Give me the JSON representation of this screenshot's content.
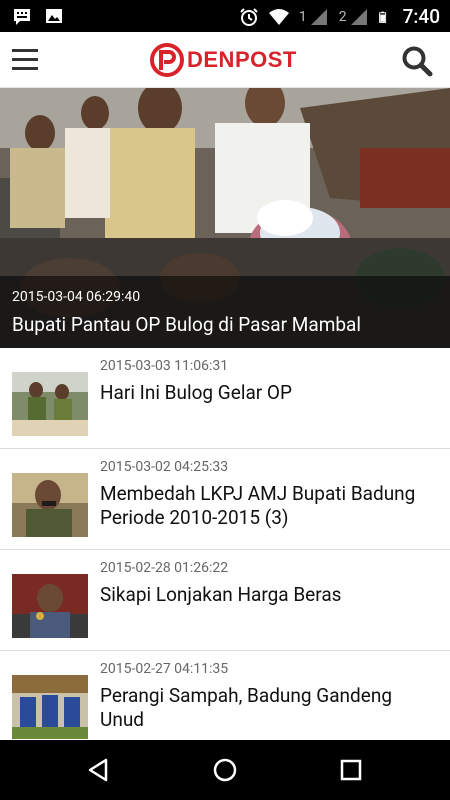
{
  "status_bar": {
    "sim1": "1",
    "sim2": "2",
    "time": "7:40",
    "icons": [
      "message-notification-icon",
      "image-notification-icon",
      "alarm-icon",
      "wifi-icon",
      "signal-icon",
      "battery-icon"
    ]
  },
  "app_bar": {
    "logo_text": "DENPOST",
    "brand_color": "#d8232a"
  },
  "hero": {
    "date": "2015-03-04 06:29:40",
    "title": "Bupati Pantau OP Bulog di Pasar Mambal"
  },
  "articles": [
    {
      "date": "2015-03-03 11:06:31",
      "title": "Hari Ini Bulog Gelar OP"
    },
    {
      "date": "2015-03-02 04:25:33",
      "title": "Membedah LKPJ AMJ Bupati Badung Periode 2010-2015 (3)"
    },
    {
      "date": "2015-02-28 01:26:22",
      "title": "Sikapi Lonjakan Harga Beras"
    },
    {
      "date": "2015-02-27 04:11:35",
      "title": "Perangi Sampah, Badung Gandeng Unud"
    }
  ]
}
